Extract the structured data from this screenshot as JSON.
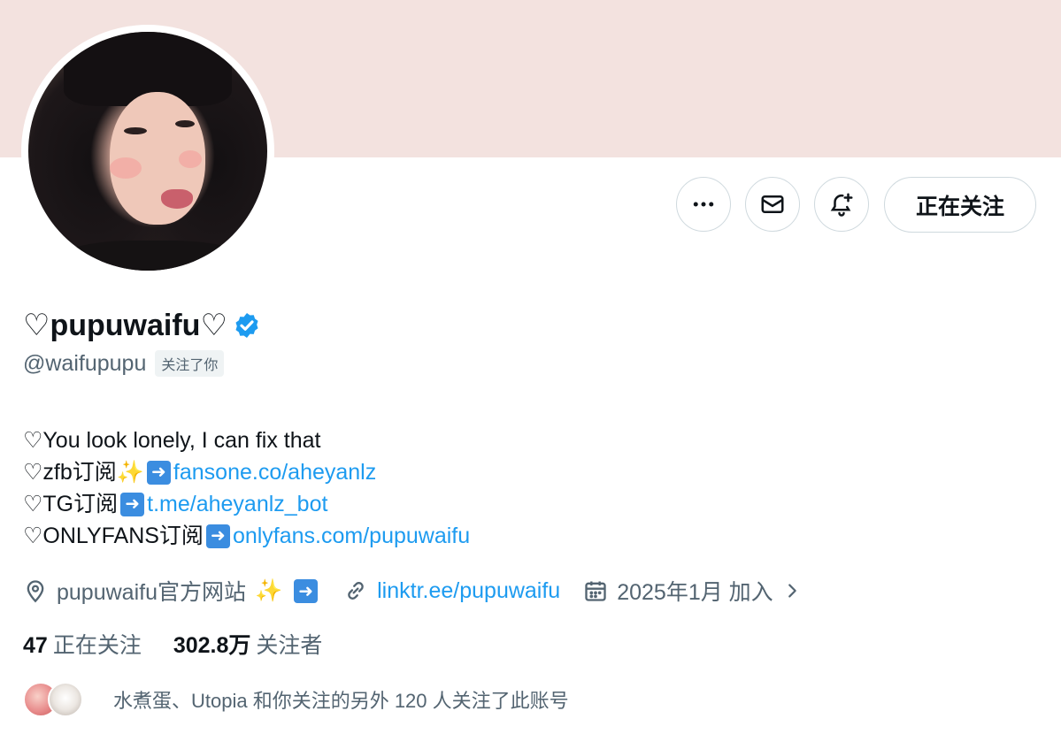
{
  "profile": {
    "display_name": "♡pupuwaifu♡",
    "handle": "@waifupupu",
    "follows_you": "关注了你",
    "following_button": "正在关注",
    "bio": {
      "line1": "♡You look lonely, I can fix that",
      "line2_prefix": "♡zfb订阅",
      "line2_link": "fansone.co/aheyanlz",
      "line3_prefix": "♡TG订阅",
      "line3_link": "t.me/aheyanlz_bot",
      "line4_prefix": "♡ONLYFANS订阅",
      "line4_link": "onlyfans.com/pupuwaifu"
    },
    "location": "pupuwaifu官方网站",
    "website": "linktr.ee/pupuwaifu",
    "joined": "2025年1月 加入",
    "following_count": "47",
    "following_label": "正在关注",
    "followers_count": "302.8万",
    "followers_label": "关注者",
    "followers_you_know": "水煮蛋、Utopia 和你关注的另外 120 人关注了此账号"
  },
  "icons": {
    "more": "more-icon",
    "message": "mail-icon",
    "notify": "bell-plus-icon",
    "verified": "verified-badge-icon",
    "location": "location-pin-icon",
    "link": "link-icon",
    "calendar": "calendar-icon",
    "chevron": "chevron-right-icon"
  },
  "colors": {
    "banner": "#f3e2df",
    "link": "#1d9bf0",
    "verified": "#1d9bf0",
    "muted_text": "#536471",
    "text": "#0f1419"
  }
}
